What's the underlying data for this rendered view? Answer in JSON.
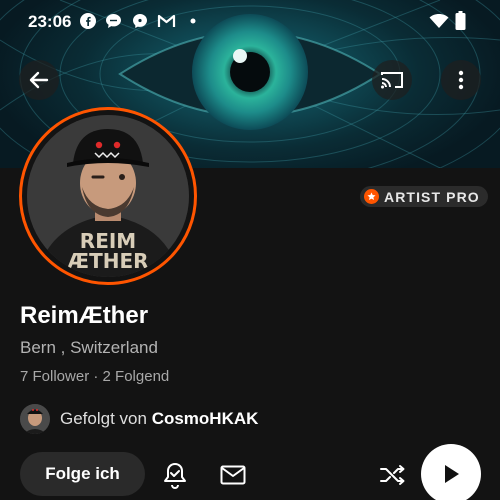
{
  "status_bar": {
    "time": "23:06",
    "notification_icons": [
      "facebook-icon",
      "chat-bubble-icon",
      "messenger-icon",
      "gmail-icon",
      "dot-icon"
    ],
    "system_icons": [
      "wifi-icon",
      "battery-icon"
    ]
  },
  "header": {
    "back_icon": "arrow-left-icon",
    "cast_icon": "cast-icon",
    "more_icon": "more-vertical-icon"
  },
  "profile": {
    "avatar_text_line1": "REIM",
    "avatar_text_line2": "ÆTHER",
    "badge": "ARTIST PRO",
    "name": "ReimÆther",
    "location": "Bern , Switzerland",
    "followers": "7 Follower",
    "separator": "·",
    "following": "2 Folgend",
    "followed_by_prefix": "Gefolgt von",
    "followed_by_name": "CosmoHKAK"
  },
  "actions": {
    "follow_label": "Folge ich",
    "notify_icon": "bell-check-icon",
    "message_icon": "mail-icon",
    "shuffle_icon": "shuffle-icon",
    "play_icon": "play-icon"
  },
  "colors": {
    "accent": "#ff5500",
    "background": "#131313",
    "button_bg": "#2a2a2a"
  }
}
